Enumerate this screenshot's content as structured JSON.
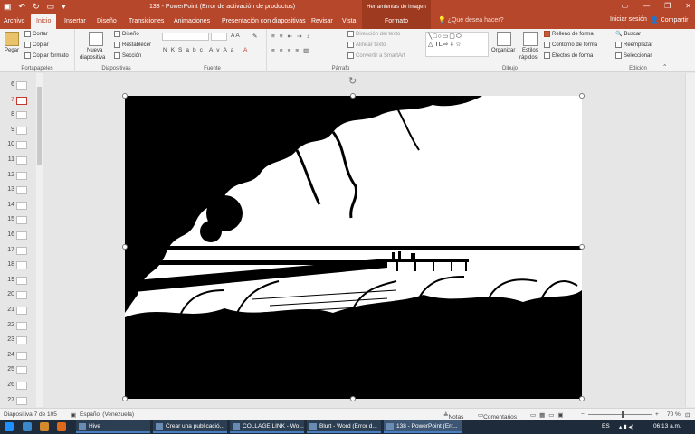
{
  "window": {
    "title": "138 - PowerPoint (Error de activación de productos)",
    "context_header": "Herramientas de imagen"
  },
  "tabs": {
    "archivo": "Archivo",
    "inicio": "Inicio",
    "insertar": "Insertar",
    "diseno": "Diseño",
    "transiciones": "Transiciones",
    "animaciones": "Animaciones",
    "presentacion": "Presentación con diapositivas",
    "revisar": "Revisar",
    "vista": "Vista",
    "formato": "Formato",
    "tell_me": "¿Qué desea hacer?",
    "signin": "Iniciar sesión",
    "share": "Compartir"
  },
  "ribbon": {
    "portapapeles": {
      "label": "Portapapeles",
      "pegar": "Pegar",
      "cortar": "Cortar",
      "copiar": "Copiar",
      "copiar_formato": "Copiar formato"
    },
    "diapositivas": {
      "label": "Diapositivas",
      "nueva": "Nueva",
      "nueva2": "diapositiva",
      "diseno": "Diseño",
      "restablecer": "Restablecer",
      "seccion": "Sección"
    },
    "fuente": {
      "label": "Fuente"
    },
    "parrafo": {
      "label": "Párrafo",
      "direccion": "Dirección del texto",
      "alinear": "Alinear texto",
      "convertir": "Convertir a SmartArt"
    },
    "dibujo": {
      "label": "Dibujo",
      "organizar": "Organizar",
      "estilos": "Estilos",
      "estilos2": "rápidos",
      "relleno": "Relleno de forma",
      "contorno": "Contorno de forma",
      "efectos": "Efectos de forma"
    },
    "edicion": {
      "label": "Edición",
      "buscar": "Buscar",
      "reemplazar": "Reemplazar",
      "seleccionar": "Seleccionar"
    }
  },
  "thumbnails": [
    "6",
    "7",
    "8",
    "9",
    "10",
    "11",
    "12",
    "13",
    "14",
    "15",
    "16",
    "17",
    "18",
    "19",
    "20",
    "21",
    "22",
    "23",
    "24",
    "25",
    "26",
    "27"
  ],
  "selected_slide": "7",
  "status": {
    "slide_info": "Diapositiva 7 de 105",
    "language": "Español (Venezuela)",
    "notas": "Notas",
    "comentarios": "Comentarios",
    "zoom": "70 %"
  },
  "taskbar": {
    "items": [
      "Hive",
      "Crear una publicació...",
      "COLLAGE LINK - Wo...",
      "Blurt - Word (Error d...",
      "138 - PowerPoint (Err..."
    ],
    "lang": "ES",
    "time": "06:13 a.m."
  },
  "colors": {
    "accent": "#b7472a",
    "context": "#9e3a1f",
    "taskbar": "#1e2b3a"
  }
}
